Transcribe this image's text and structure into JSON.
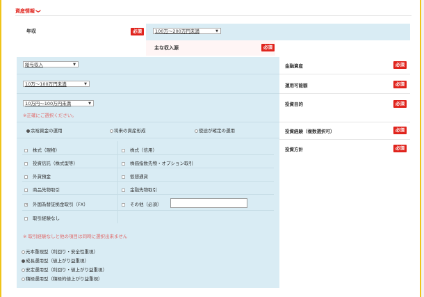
{
  "section": {
    "title": "資産情報",
    "chevron": "❯"
  },
  "required_label": "必須",
  "annual_income": {
    "label": "年収",
    "value": "100万～200万円未満"
  },
  "main_income": {
    "label": "主な収入源",
    "value": "給与収入"
  },
  "financial_assets": {
    "label": "金融資産",
    "value": "10万～100万円未満"
  },
  "usable_amount": {
    "label": "運用可能額",
    "value": "10万円～100万円未満",
    "error": "※正確にご選択ください。"
  },
  "investment_purpose": {
    "label": "投資目的",
    "options": [
      {
        "label": "余裕資金の運用",
        "selected": true
      },
      {
        "label": "将来の資産形成",
        "selected": false
      },
      {
        "label": "使途が確定の運用",
        "selected": false
      }
    ]
  },
  "investment_experience": {
    "label": "投資経験（複数選択可）",
    "items": [
      {
        "label": "株式（現物）",
        "checked": false
      },
      {
        "label": "株式（信用）",
        "checked": false
      },
      {
        "label": "投資信託（株式型等）",
        "checked": false
      },
      {
        "label": "株価指数先物・オプション取引",
        "checked": false
      },
      {
        "label": "外貨預金",
        "checked": false
      },
      {
        "label": "仮想通貨",
        "checked": false
      },
      {
        "label": "商品先物取引",
        "checked": false
      },
      {
        "label": "金融先物取引",
        "checked": false
      },
      {
        "label": "外国為替証拠金取引（FX）",
        "checked": true
      },
      {
        "label": "その他（必須）",
        "checked": false
      },
      {
        "label": "取引経験なし",
        "checked": false
      }
    ],
    "other_value": "",
    "note": "※ 取引経験なしと他の項目は同時に選択出来ません"
  },
  "investment_policy": {
    "label": "投資方針",
    "options": [
      {
        "label": "元本重視型（利回り・安全性重視）",
        "selected": false
      },
      {
        "label": "成長運用型（値上がり益重視）",
        "selected": true
      },
      {
        "label": "安定運用型（利回り・値上がり益重視）",
        "selected": false
      },
      {
        "label": "積極運用型（積極的値上がり益重視）",
        "selected": false
      }
    ]
  }
}
